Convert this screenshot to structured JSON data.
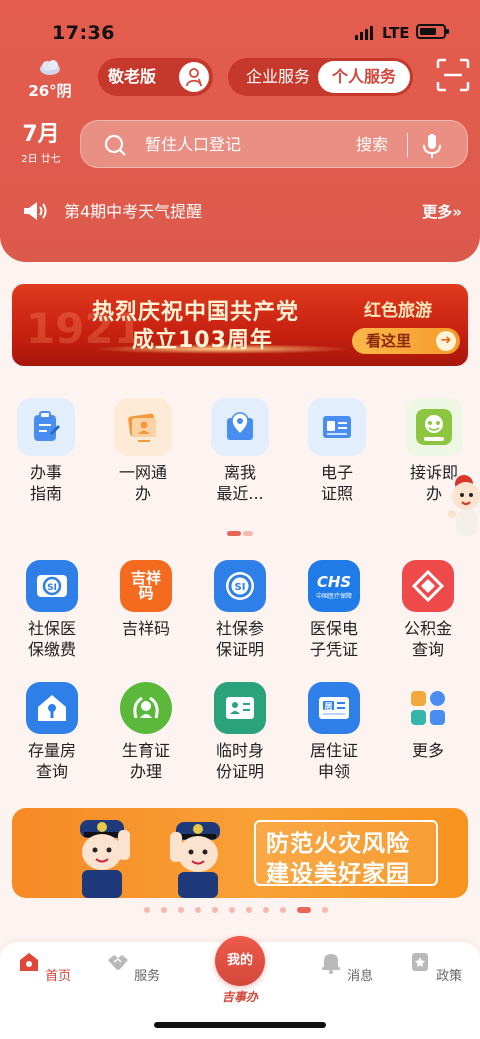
{
  "status": {
    "time": "17:36",
    "network": "LTE"
  },
  "header": {
    "weather": {
      "temp": "26°阴"
    },
    "elder_mode": "敬老版",
    "segments": [
      "企业服务",
      "个人服务"
    ],
    "date": {
      "month": "7月",
      "day": "2日 廿七"
    },
    "search": {
      "placeholder": "暂住人口登记",
      "button": "搜索"
    },
    "notice": {
      "text": "第4期中考天气提醒",
      "more": "更多»"
    }
  },
  "banner": {
    "line1": "热烈庆祝中国共产党",
    "line2": "成立103周年",
    "tag": "红色旅游",
    "cta": "看这里",
    "watermark": "1921"
  },
  "top_services": [
    {
      "label": "办事\n指南",
      "icon": "clipboard-icon",
      "color": "#4a8df0"
    },
    {
      "label": "一网通\n办",
      "icon": "screen-icon",
      "color": "#f49a3c"
    },
    {
      "label": "离我\n最近...",
      "icon": "location-icon",
      "color": "#4a8df0"
    },
    {
      "label": "电子\n证照",
      "icon": "id-card-icon",
      "color": "#4a8df0"
    },
    {
      "label": "接诉即\n办",
      "icon": "family-icon",
      "color": "#8cc63f"
    }
  ],
  "grid": [
    {
      "label": "社保医\n保缴费",
      "icon": "si-card-icon",
      "color": "#2f7fe8"
    },
    {
      "label": "吉祥码",
      "icon": "jixiang-code-icon",
      "color": "#f46a1f"
    },
    {
      "label": "社保参\n保证明",
      "icon": "si-circle-icon",
      "color": "#2f7fe8"
    },
    {
      "label": "医保电\n子凭证",
      "icon": "chs-icon",
      "color": "#1f7be8"
    },
    {
      "label": "公积金\n查询",
      "icon": "fund-icon",
      "color": "#ef4a4a"
    },
    {
      "label": "存量房\n查询",
      "icon": "house-key-icon",
      "color": "#2f7fe8"
    },
    {
      "label": "生育证\n办理",
      "icon": "birth-icon",
      "color": "#5cb83a"
    },
    {
      "label": "临时身\n份证明",
      "icon": "temp-id-icon",
      "color": "#2aa37a"
    },
    {
      "label": "居住证\n申领",
      "icon": "residence-icon",
      "color": "#2f7fe8"
    },
    {
      "label": "更多",
      "icon": "more-grid-icon",
      "color": "#f2a93b"
    }
  ],
  "grid_badges": {
    "chs": "CHS",
    "chs_sub": "中国医疗保障",
    "si": "SI",
    "jixiang": "吉祥\n码",
    "residence": "居"
  },
  "fire_banner": {
    "line1": "防范火灾风险",
    "line2": "建设美好家园"
  },
  "tabbar": {
    "tabs": [
      "首页",
      "服务",
      "消息",
      "政策"
    ],
    "center": "我的",
    "center_sub": "吉事办"
  },
  "colors": {
    "primary": "#d3473b",
    "header": "#e45d4e"
  }
}
